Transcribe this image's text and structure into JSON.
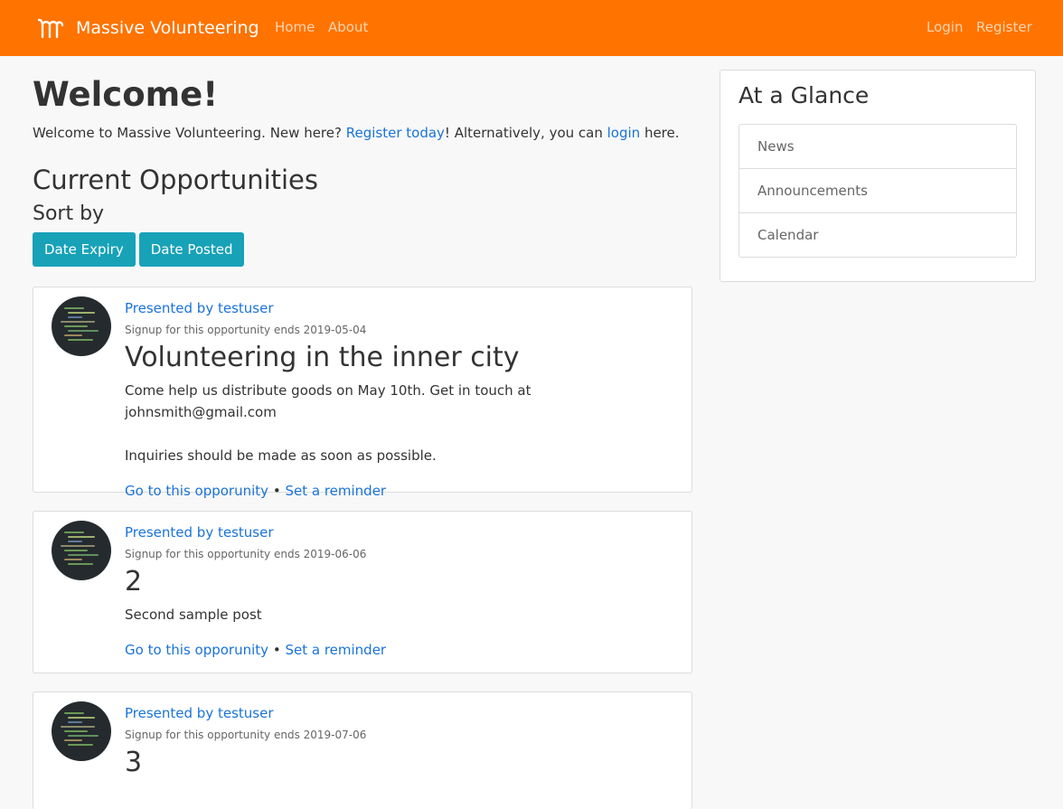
{
  "navbar": {
    "brand": "Massive Volunteering",
    "brand_icon": "m-logo-icon",
    "links": [
      "Home",
      "About"
    ],
    "auth": [
      "Login",
      "Register"
    ],
    "bg_color": "#ff7300"
  },
  "welcome": {
    "heading": "Welcome!",
    "intro_pre": "Welcome to Massive Volunteering. New here? ",
    "register_link": "Register today",
    "intro_mid": "! Alternatively, you can ",
    "login_link": "login",
    "intro_post": " here."
  },
  "opportunities": {
    "heading": "Current Opportunities",
    "sort_heading": "Sort by",
    "sort_buttons": [
      "Date Expiry",
      "Date Posted"
    ],
    "posts": [
      {
        "author": "Presented by testuser",
        "signup": "Signup for this opportunity ends 2019-05-04",
        "title": "Volunteering in the inner city",
        "desc_line1": "Come help us distribute goods on May 10th. Get in touch at johnsmith@gmail.com",
        "desc_line2": "Inquiries should be made as soon as possible.",
        "go_link": "Go to this opporunity",
        "separator": "•",
        "reminder_link": "Set a reminder"
      },
      {
        "author": "Presented by testuser",
        "signup": "Signup for this opportunity ends 2019-06-06",
        "title": "2",
        "desc_line1": "Second sample post",
        "go_link": "Go to this opporunity",
        "separator": "•",
        "reminder_link": "Set a reminder"
      },
      {
        "author": "Presented by testuser",
        "signup": "Signup for this opportunity ends 2019-07-06",
        "title": "3"
      }
    ]
  },
  "sidebar": {
    "heading": "At a Glance",
    "items": [
      "News",
      "Announcements",
      "Calendar"
    ]
  }
}
